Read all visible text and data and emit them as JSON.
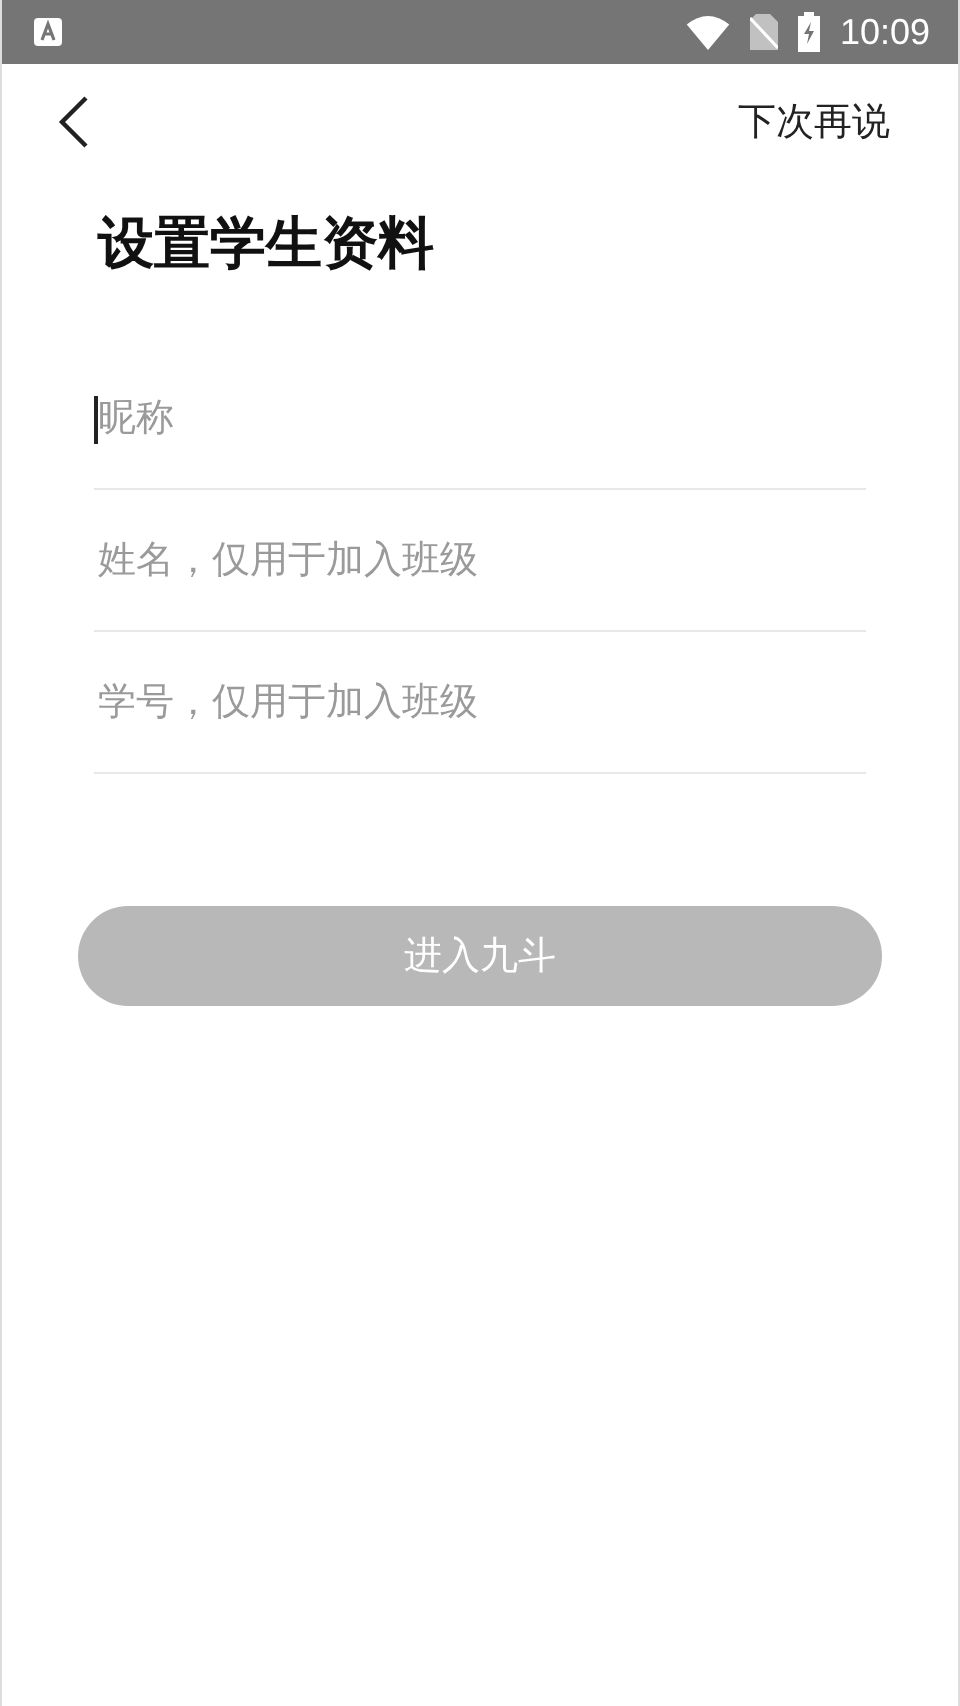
{
  "status_bar": {
    "time": "10:09"
  },
  "header": {
    "skip_link": "下次再说"
  },
  "title": "设置学生资料",
  "fields": [
    {
      "placeholder": "昵称",
      "focused": true
    },
    {
      "placeholder": "姓名，仅用于加入班级",
      "focused": false
    },
    {
      "placeholder": "学号，仅用于加入班级",
      "focused": false
    }
  ],
  "submit": {
    "label": "进入九斗",
    "disabled": true
  }
}
